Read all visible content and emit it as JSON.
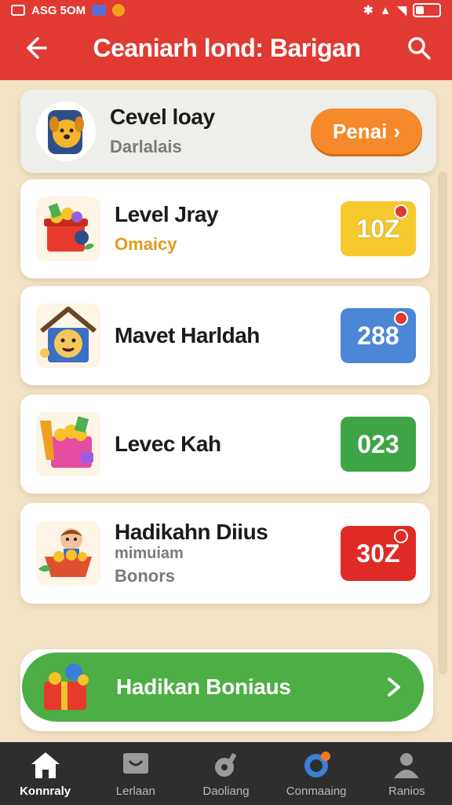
{
  "status_bar": {
    "left_text": "ASG 5OM"
  },
  "header": {
    "title": "Ceaniarh lond: Barigan"
  },
  "cards": [
    {
      "title": "Cevel loay",
      "subtitle": "Darlalais",
      "button_label": "Penai"
    },
    {
      "title": "Level Jray",
      "subtitle": "Omaicy",
      "badge_value": "10Z",
      "badge_color": "#f6c92e"
    },
    {
      "title": "Mavet Harldah",
      "badge_value": "288",
      "badge_color": "#4c86d6"
    },
    {
      "title": "Levec Kah",
      "badge_value": "023",
      "badge_color": "#3fa445"
    },
    {
      "title": "Hadikahn Diius",
      "subtitle": "mimuiam",
      "subtitle2": "Bonors",
      "badge_value": "30Z",
      "badge_color": "#e02a26"
    }
  ],
  "cta": {
    "label": "Hadikan Boniaus"
  },
  "bottom_nav": [
    {
      "label": "Konnraly",
      "icon": "home-icon",
      "active": true
    },
    {
      "label": "Lerlaan",
      "icon": "chat-icon",
      "active": false
    },
    {
      "label": "Daoliang",
      "icon": "wrench-icon",
      "active": false
    },
    {
      "label": "Conmaaing",
      "icon": "compass-icon",
      "active": false
    },
    {
      "label": "Ranios",
      "icon": "profile-icon",
      "active": false
    }
  ],
  "colors": {
    "header": "#e03a33",
    "background": "#f3e4c6",
    "cta": "#4cae44",
    "primary_button": "#f5892b"
  }
}
